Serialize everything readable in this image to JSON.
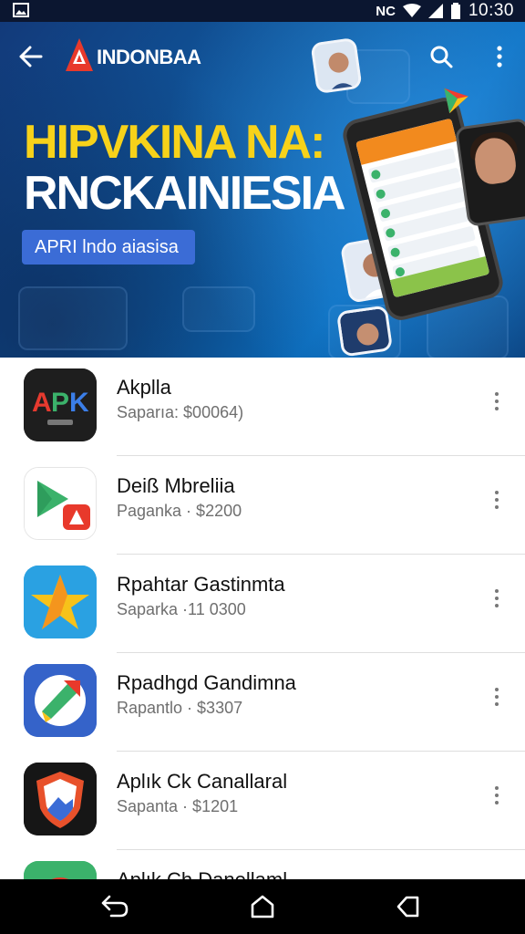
{
  "status_bar": {
    "time": "10:30",
    "icons": [
      "gallery-icon",
      "nfc-icon",
      "wifi-icon",
      "signal-icon",
      "battery-icon"
    ],
    "nfc_text": "NC"
  },
  "app_bar": {
    "brand_name": "INDONBAA",
    "icons": [
      "back-arrow-icon",
      "brand-logo",
      "search-icon",
      "more-vertical-icon"
    ]
  },
  "banner": {
    "headline_line1": "HIPVKINA NA:",
    "headline_line2": "RNCKAINIESIA",
    "chip_label": "APRI lndo aiasisa",
    "colors": {
      "headline_yellow": "#f7d21a",
      "chip_blue": "#3b6cd6",
      "banner_blue": "#0f5aa0"
    }
  },
  "apps": [
    {
      "title": "Akplla",
      "subtitle": "Saparıa: $00064)",
      "icon": "apk-icon"
    },
    {
      "title": "Deiß Mbreliia",
      "subtitle": "Paganka · $2200",
      "icon": "play-store-icon"
    },
    {
      "title": "Rpahtar Gastinmta",
      "subtitle": "Saparka ·11 0300",
      "icon": "star-icon"
    },
    {
      "title": "Rpadhgd Gandimna",
      "subtitle": "Rapantlo · $3307",
      "icon": "arrow-badge-icon"
    },
    {
      "title": "Aplık Ck Canallaral",
      "subtitle": "Sapanta · $1201",
      "icon": "shield-icon"
    },
    {
      "title": "Aplık Ch Danellaml",
      "subtitle": "",
      "icon": "green-app-icon"
    }
  ],
  "nav_bar": {
    "icons": [
      "nav-back-icon",
      "nav-home-icon",
      "nav-recents-icon"
    ]
  }
}
